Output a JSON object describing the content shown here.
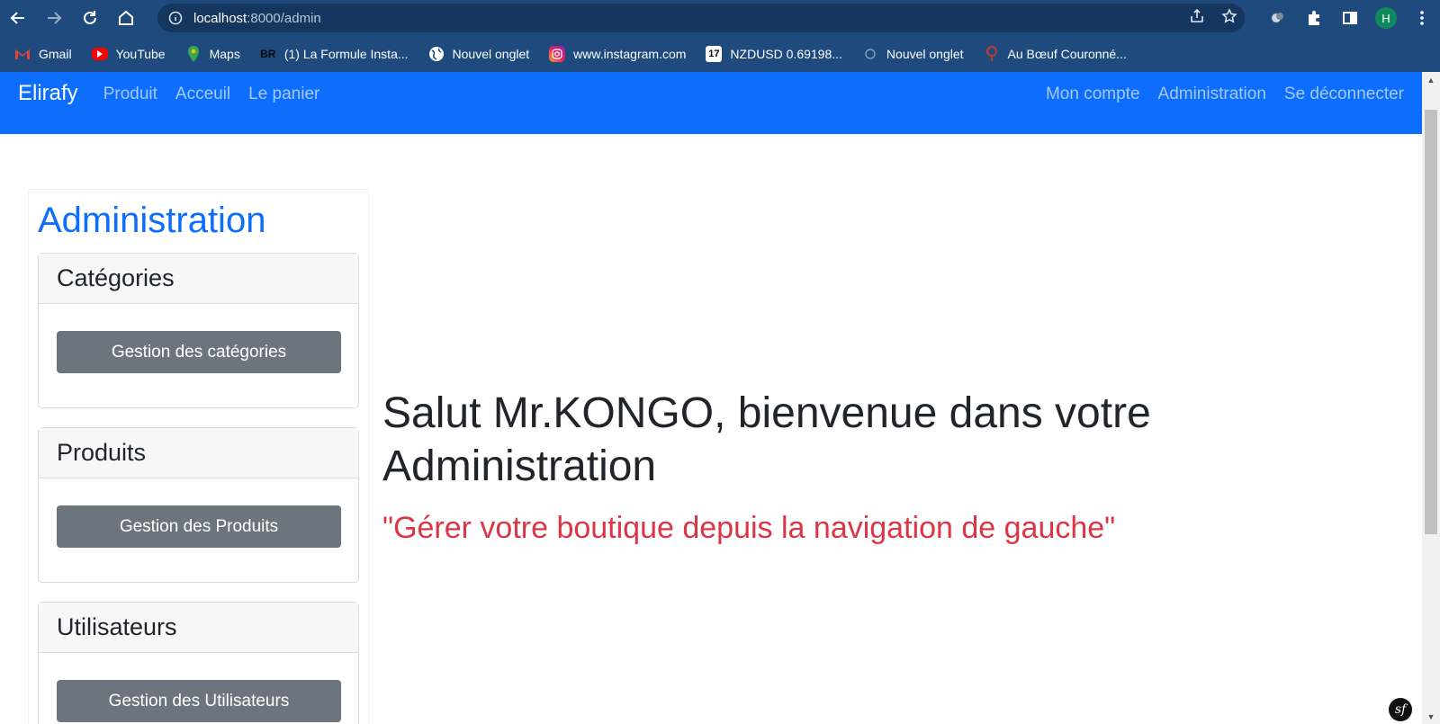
{
  "browser": {
    "url_host": "localhost",
    "url_rest": ":8000/admin",
    "profile_initial": "H",
    "bookmarks": [
      {
        "label": "Gmail",
        "icon": "gmail-icon"
      },
      {
        "label": "YouTube",
        "icon": "youtube-icon"
      },
      {
        "label": "Maps",
        "icon": "maps-icon"
      },
      {
        "label": "(1) La Formule Insta...",
        "icon": "br-icon",
        "icon_text": "BR"
      },
      {
        "label": "Nouvel onglet",
        "icon": "globe-icon"
      },
      {
        "label": "www.instagram.com",
        "icon": "instagram-icon"
      },
      {
        "label": "NZDUSD 0.69198...",
        "icon": "tradingview-icon",
        "icon_text": "17"
      },
      {
        "label": "Nouvel onglet",
        "icon": "page-icon"
      },
      {
        "label": "Au Bœuf Couronné...",
        "icon": "restaurant-icon"
      }
    ]
  },
  "navbar": {
    "brand": "Elirafy",
    "left_links": [
      "Produit",
      "Acceuil",
      "Le panier"
    ],
    "right_links": [
      "Mon compte",
      "Administration",
      "Se déconnecter"
    ]
  },
  "sidebar": {
    "title": "Administration",
    "cards": [
      {
        "header": "Catégories",
        "button": "Gestion des catégories"
      },
      {
        "header": "Produits",
        "button": "Gestion des Produits"
      },
      {
        "header": "Utilisateurs",
        "button": "Gestion des Utilisateurs"
      }
    ]
  },
  "main": {
    "title": "Salut Mr.KONGO, bienvenue dans votre Administration",
    "subtitle": "\"Gérer votre boutique depuis la navigation de gauche\""
  },
  "colors": {
    "chrome": "#1e4a7e",
    "navbar": "#0d6efd",
    "button": "#6c757d",
    "subtitle": "#dc3545"
  },
  "debug_badge": "sf"
}
